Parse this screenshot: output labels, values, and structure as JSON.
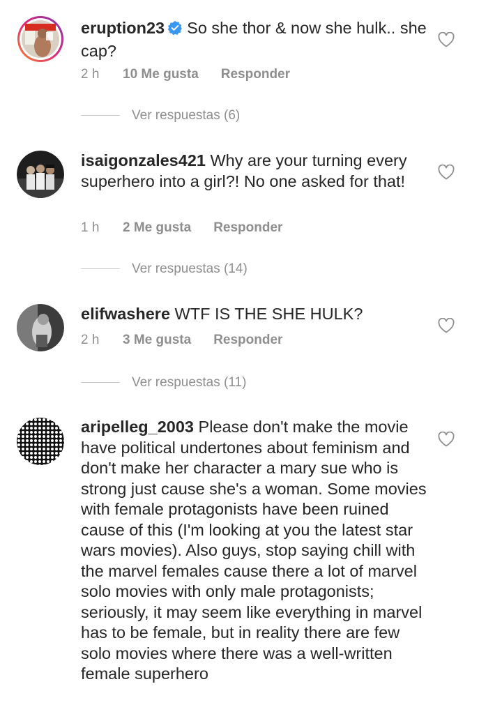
{
  "comments": [
    {
      "username": "eruption23",
      "verified": true,
      "text": "So she thor & now she hulk.. she cap?",
      "time": "2 h",
      "likes": "10 Me gusta",
      "reply": "Responder",
      "view_replies": "Ver respuestas (6)"
    },
    {
      "username": "isaigonzales421",
      "verified": false,
      "text": "Why are your turning every superhero into a girl?! No one asked for that!",
      "time": "1 h",
      "likes": "2 Me gusta",
      "reply": "Responder",
      "view_replies": "Ver respuestas (14)"
    },
    {
      "username": "elifwashere",
      "verified": false,
      "text": "WTF IS THE SHE HULK?",
      "time": "2 h",
      "likes": "3 Me gusta",
      "reply": "Responder",
      "view_replies": "Ver respuestas (11)"
    },
    {
      "username": "aripelleg_2003",
      "verified": false,
      "text": "Please don't make the movie have political undertones about feminism and don't make her character a mary sue who is strong just cause she's a woman. Some movies with female protagonists have been ruined cause of this (I'm looking at you the latest star wars movies). Also guys, stop saying chill with the marvel females cause there a lot of marvel solo movies with only male protagonists; seriously, it may seem like everything in marvel has to be female, but in reality there are few solo movies where there was a well-written female superhero"
    }
  ],
  "icons": {
    "verified_badge": "verified-badge-icon",
    "like": "heart-outline-icon"
  },
  "colors": {
    "text": "#262626",
    "muted": "#8e8e8e",
    "verified": "#3897f0",
    "story_ring_start": "#f58529",
    "story_ring_end": "#dd2a7b"
  }
}
